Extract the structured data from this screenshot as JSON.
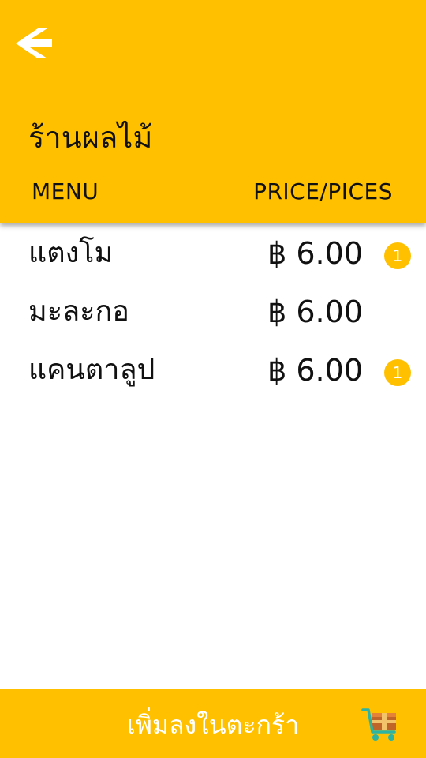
{
  "header": {
    "back_icon": "back-arrow-icon",
    "title": "ร้านผลไม้",
    "col_menu": "MENU",
    "col_price": "PRICE/PICES",
    "background_color": "#FFC000"
  },
  "items": [
    {
      "name": "แตงโม",
      "price": "฿ 6.00",
      "badge": "1"
    },
    {
      "name": "มะละกอ",
      "price": "฿ 6.00",
      "badge": ""
    },
    {
      "name": "แคนตาลูป",
      "price": "฿ 6.00",
      "badge": "1"
    }
  ],
  "footer": {
    "label": "เพิ่มลงในตะกร้า",
    "cart_icon": "shopping-cart-icon"
  }
}
